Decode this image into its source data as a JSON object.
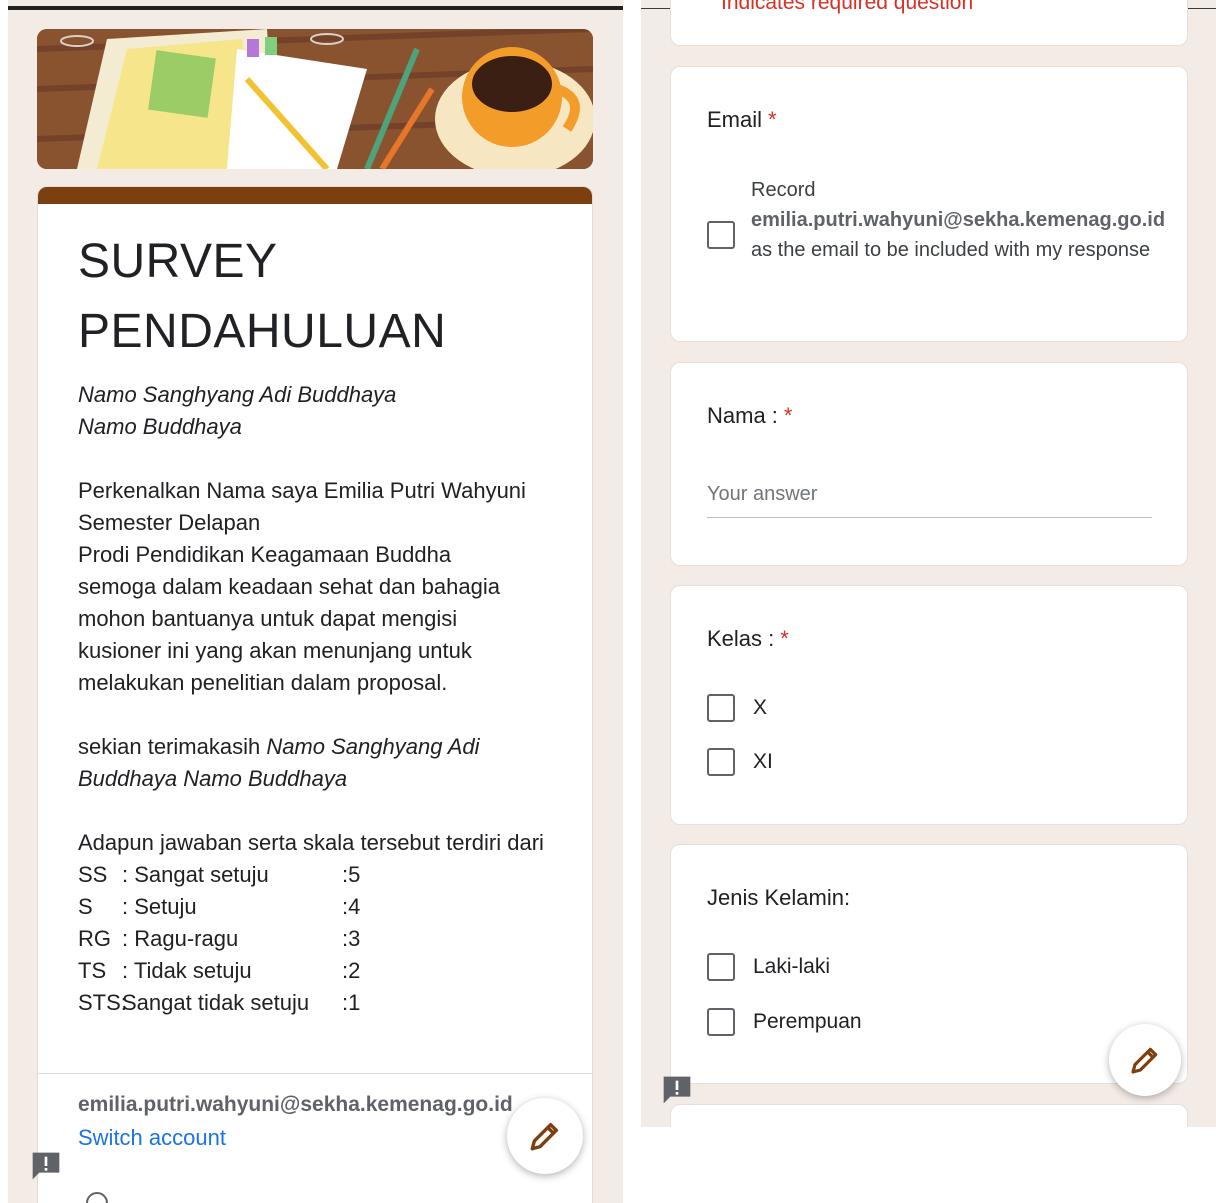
{
  "left": {
    "title": "SURVEY PENDAHULUAN",
    "greeting_line1": "Namo Sanghyang Adi Buddhaya",
    "greeting_line2": "Namo Buddhaya",
    "intro": "Perkenalkan Nama saya Emilia Putri Wahyuni\nSemester Delapan\nProdi Pendidikan Keagamaan Buddha\nsemoga dalam keadaan sehat dan bahagia\nmohon bantuanya untuk dapat mengisi\nkusioner ini yang akan menunjang untuk\nmelakukan penelitian dalam proposal.",
    "closing_prefix": "sekian terimakasih ",
    "closing_italic": "Namo Sanghyang Adi Buddhaya Namo Buddhaya",
    "scale_intro": "Adapun jawaban serta skala tersebut terdiri dari",
    "scale": [
      {
        "code": "SS",
        "label": ": Sangat setuju",
        "value": ":5"
      },
      {
        "code": "S",
        "label": ": Setuju",
        "value": ":4"
      },
      {
        "code": "RG",
        "label": ": Ragu-ragu",
        "value": ":3"
      },
      {
        "code": "TS",
        "label": ": Tidak setuju",
        "value": ":2"
      },
      {
        "code": "STS:",
        "label": " Sangat tidak setuju",
        "value": ":1"
      }
    ],
    "account_email": "emilia.putri.wahyuni@sekha.kemenag.go.id",
    "switch_account": "Switch account"
  },
  "right": {
    "required_note": "Indicates required question",
    "email_question": {
      "label": "Email",
      "record_prefix": "Record",
      "record_email": "emilia.putri.wahyuni@sekha.kemenag.go.id",
      "record_suffix": "as the email to be included with my response"
    },
    "nama_question": {
      "label": "Nama :",
      "placeholder": "Your answer"
    },
    "kelas_question": {
      "label": "Kelas :",
      "options": [
        "X",
        "XI"
      ]
    },
    "jenis_question": {
      "label": "Jenis Kelamin:",
      "options": [
        "Laki-laki",
        "Perempuan"
      ]
    }
  },
  "colors": {
    "accent": "#7b3f10",
    "background": "#f3ebe6",
    "required": "#d93025",
    "link": "#1a73e8"
  },
  "icons": {
    "fab": "pencil-icon",
    "feedback": "feedback-icon"
  }
}
